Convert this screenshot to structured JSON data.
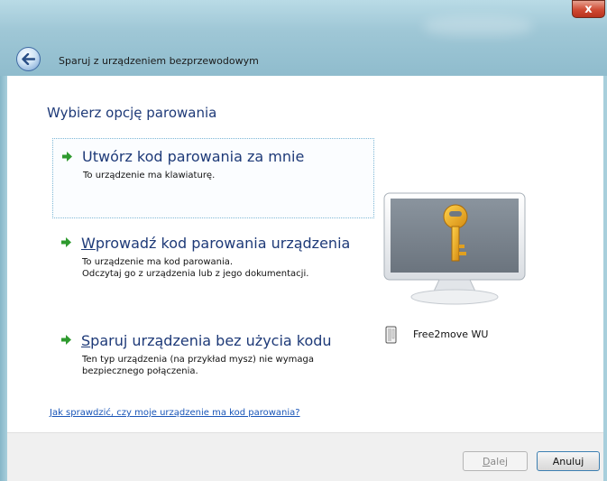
{
  "window": {
    "title": "Sparuj z urządzeniem bezprzewodowym",
    "close_label": "x"
  },
  "heading": "Wybierz opcję parowania",
  "options": [
    {
      "title": "Utwórz kod parowania za mnie",
      "desc_lines": [
        "To urządzenie ma klawiaturę."
      ],
      "selected": true
    },
    {
      "title_prefix": "W",
      "title_rest": "prowadź kod parowania urządzenia",
      "desc_lines": [
        "To urządzenie ma kod parowania.",
        "Odczytaj go z urządzenia lub z jego dokumentacji."
      ],
      "selected": false
    },
    {
      "title_prefix": "S",
      "title_rest": "paruj urządzenia bez użycia kodu",
      "desc_lines": [
        "Ten typ urządzenia (na przykład mysz) nie wymaga",
        "bezpiecznego połączenia."
      ],
      "selected": false
    }
  ],
  "help_link": "Jak sprawdzić, czy moje urządzenie ma kod parowania?",
  "device": {
    "name": "Free2move WU",
    "icon": "device-icon"
  },
  "buttons": {
    "next_prefix": "D",
    "next_rest": "alej",
    "cancel": "Anuluj"
  },
  "colors": {
    "heading": "#1e3a78",
    "link": "#1a56b8",
    "arrow": "#2e9a2e",
    "key": "#e8a21a"
  }
}
